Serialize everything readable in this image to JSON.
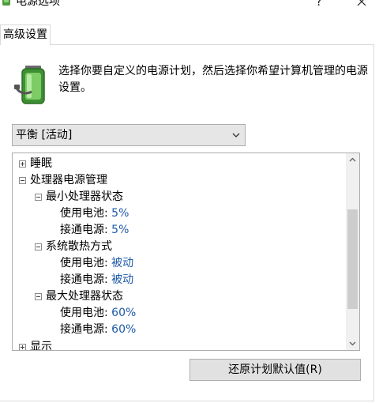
{
  "window": {
    "title": "电源选项"
  },
  "tabs": [
    {
      "label": "高级设置"
    }
  ],
  "description": "选择你要自定义的电源计划，然后选择你希望计算机管理的电源设置。",
  "plan_select": {
    "value": "平衡 [活动]"
  },
  "tree": {
    "sleep": {
      "label": "睡眠"
    },
    "processor_power": {
      "label": "处理器电源管理"
    },
    "min_state": {
      "label": "最小处理器状态",
      "battery_label": "使用电池:",
      "battery_value": "5%",
      "plugged_label": "接通电源:",
      "plugged_value": "5%"
    },
    "cooling": {
      "label": "系统散热方式",
      "battery_label": "使用电池:",
      "battery_value": "被动",
      "plugged_label": "接通电源:",
      "plugged_value": "被动"
    },
    "max_state": {
      "label": "最大处理器状态",
      "battery_label": "使用电池:",
      "battery_value": "60%",
      "plugged_label": "接通电源:",
      "plugged_value": "60%"
    },
    "display": {
      "label": "显示"
    }
  },
  "buttons": {
    "restore": "还原计划默认值(R)"
  },
  "icons": {
    "titlebar": "battery-plug-icon",
    "help": "question-icon",
    "close": "close-icon",
    "header": "battery-icon",
    "dropdown": "chevron-down-icon",
    "scroll_up": "chevron-up-icon",
    "scroll_down": "chevron-down-icon"
  },
  "colors": {
    "value_text": "#1e5aa8",
    "battery_green": "#55a845"
  }
}
